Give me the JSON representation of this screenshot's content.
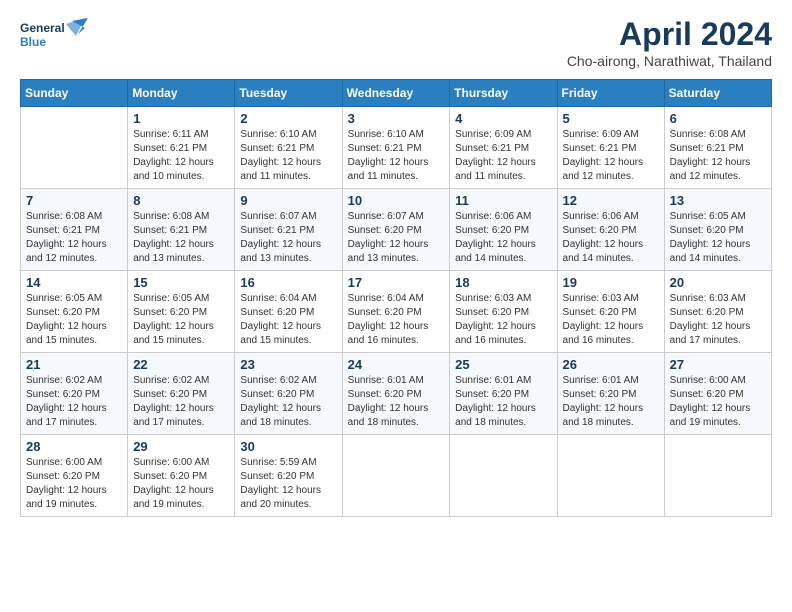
{
  "header": {
    "logo_line1": "General",
    "logo_line2": "Blue",
    "month_year": "April 2024",
    "location": "Cho-airong, Narathiwat, Thailand"
  },
  "calendar": {
    "days_of_week": [
      "Sunday",
      "Monday",
      "Tuesday",
      "Wednesday",
      "Thursday",
      "Friday",
      "Saturday"
    ],
    "weeks": [
      [
        {
          "day": "",
          "info": ""
        },
        {
          "day": "1",
          "info": "Sunrise: 6:11 AM\nSunset: 6:21 PM\nDaylight: 12 hours\nand 10 minutes."
        },
        {
          "day": "2",
          "info": "Sunrise: 6:10 AM\nSunset: 6:21 PM\nDaylight: 12 hours\nand 11 minutes."
        },
        {
          "day": "3",
          "info": "Sunrise: 6:10 AM\nSunset: 6:21 PM\nDaylight: 12 hours\nand 11 minutes."
        },
        {
          "day": "4",
          "info": "Sunrise: 6:09 AM\nSunset: 6:21 PM\nDaylight: 12 hours\nand 11 minutes."
        },
        {
          "day": "5",
          "info": "Sunrise: 6:09 AM\nSunset: 6:21 PM\nDaylight: 12 hours\nand 12 minutes."
        },
        {
          "day": "6",
          "info": "Sunrise: 6:08 AM\nSunset: 6:21 PM\nDaylight: 12 hours\nand 12 minutes."
        }
      ],
      [
        {
          "day": "7",
          "info": "Sunrise: 6:08 AM\nSunset: 6:21 PM\nDaylight: 12 hours\nand 12 minutes."
        },
        {
          "day": "8",
          "info": "Sunrise: 6:08 AM\nSunset: 6:21 PM\nDaylight: 12 hours\nand 13 minutes."
        },
        {
          "day": "9",
          "info": "Sunrise: 6:07 AM\nSunset: 6:21 PM\nDaylight: 12 hours\nand 13 minutes."
        },
        {
          "day": "10",
          "info": "Sunrise: 6:07 AM\nSunset: 6:20 PM\nDaylight: 12 hours\nand 13 minutes."
        },
        {
          "day": "11",
          "info": "Sunrise: 6:06 AM\nSunset: 6:20 PM\nDaylight: 12 hours\nand 14 minutes."
        },
        {
          "day": "12",
          "info": "Sunrise: 6:06 AM\nSunset: 6:20 PM\nDaylight: 12 hours\nand 14 minutes."
        },
        {
          "day": "13",
          "info": "Sunrise: 6:05 AM\nSunset: 6:20 PM\nDaylight: 12 hours\nand 14 minutes."
        }
      ],
      [
        {
          "day": "14",
          "info": "Sunrise: 6:05 AM\nSunset: 6:20 PM\nDaylight: 12 hours\nand 15 minutes."
        },
        {
          "day": "15",
          "info": "Sunrise: 6:05 AM\nSunset: 6:20 PM\nDaylight: 12 hours\nand 15 minutes."
        },
        {
          "day": "16",
          "info": "Sunrise: 6:04 AM\nSunset: 6:20 PM\nDaylight: 12 hours\nand 15 minutes."
        },
        {
          "day": "17",
          "info": "Sunrise: 6:04 AM\nSunset: 6:20 PM\nDaylight: 12 hours\nand 16 minutes."
        },
        {
          "day": "18",
          "info": "Sunrise: 6:03 AM\nSunset: 6:20 PM\nDaylight: 12 hours\nand 16 minutes."
        },
        {
          "day": "19",
          "info": "Sunrise: 6:03 AM\nSunset: 6:20 PM\nDaylight: 12 hours\nand 16 minutes."
        },
        {
          "day": "20",
          "info": "Sunrise: 6:03 AM\nSunset: 6:20 PM\nDaylight: 12 hours\nand 17 minutes."
        }
      ],
      [
        {
          "day": "21",
          "info": "Sunrise: 6:02 AM\nSunset: 6:20 PM\nDaylight: 12 hours\nand 17 minutes."
        },
        {
          "day": "22",
          "info": "Sunrise: 6:02 AM\nSunset: 6:20 PM\nDaylight: 12 hours\nand 17 minutes."
        },
        {
          "day": "23",
          "info": "Sunrise: 6:02 AM\nSunset: 6:20 PM\nDaylight: 12 hours\nand 18 minutes."
        },
        {
          "day": "24",
          "info": "Sunrise: 6:01 AM\nSunset: 6:20 PM\nDaylight: 12 hours\nand 18 minutes."
        },
        {
          "day": "25",
          "info": "Sunrise: 6:01 AM\nSunset: 6:20 PM\nDaylight: 12 hours\nand 18 minutes."
        },
        {
          "day": "26",
          "info": "Sunrise: 6:01 AM\nSunset: 6:20 PM\nDaylight: 12 hours\nand 18 minutes."
        },
        {
          "day": "27",
          "info": "Sunrise: 6:00 AM\nSunset: 6:20 PM\nDaylight: 12 hours\nand 19 minutes."
        }
      ],
      [
        {
          "day": "28",
          "info": "Sunrise: 6:00 AM\nSunset: 6:20 PM\nDaylight: 12 hours\nand 19 minutes."
        },
        {
          "day": "29",
          "info": "Sunrise: 6:00 AM\nSunset: 6:20 PM\nDaylight: 12 hours\nand 19 minutes."
        },
        {
          "day": "30",
          "info": "Sunrise: 5:59 AM\nSunset: 6:20 PM\nDaylight: 12 hours\nand 20 minutes."
        },
        {
          "day": "",
          "info": ""
        },
        {
          "day": "",
          "info": ""
        },
        {
          "day": "",
          "info": ""
        },
        {
          "day": "",
          "info": ""
        }
      ]
    ]
  }
}
